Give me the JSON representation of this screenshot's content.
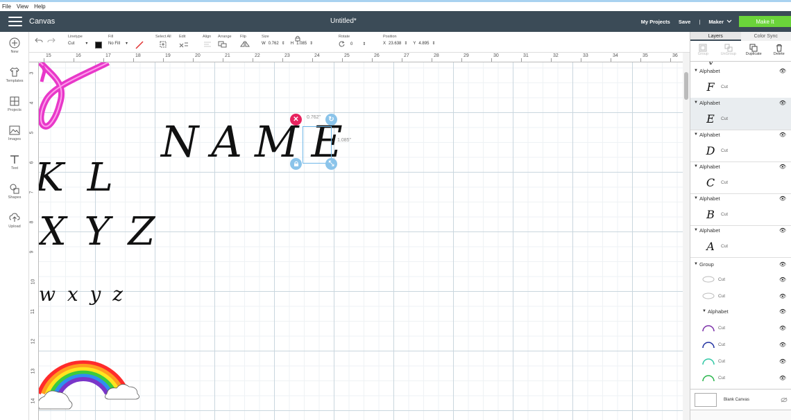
{
  "menu": [
    "File",
    "View",
    "Help"
  ],
  "header": {
    "app": "Canvas",
    "doc_title": "Untitled*",
    "my_projects": "My Projects",
    "save": "Save",
    "separator": "|",
    "machine": "Maker",
    "make_it": "Make It"
  },
  "toolbar": {
    "linetype_label": "Linetype",
    "linetype_value": "Cut",
    "fill_label": "Fill",
    "fill_value": "No Fill",
    "select_all_label": "Select All",
    "edit_label": "Edit",
    "align_label": "Align",
    "arrange_label": "Arrange",
    "flip_label": "Flip",
    "size_label": "Size",
    "w_label": "W",
    "w_value": "0.762",
    "h_label": "H",
    "h_value": "1.085",
    "rotate_label": "Rotate",
    "rotate_value": "0",
    "position_label": "Position",
    "x_label": "X",
    "x_value": "23.638",
    "y_label": "Y",
    "y_value": "4.895"
  },
  "sidebar": {
    "items": [
      {
        "label": "New",
        "icon": "plus-circle-icon"
      },
      {
        "label": "Templates",
        "icon": "shirt-icon"
      },
      {
        "label": "Projects",
        "icon": "projects-icon"
      },
      {
        "label": "Images",
        "icon": "image-icon"
      },
      {
        "label": "Text",
        "icon": "text-icon"
      },
      {
        "label": "Shapes",
        "icon": "shapes-icon"
      },
      {
        "label": "Upload",
        "icon": "upload-icon"
      }
    ]
  },
  "ruler": {
    "top": [
      "15",
      "16",
      "17",
      "18",
      "19",
      "20",
      "21",
      "22",
      "23",
      "24",
      "25",
      "26",
      "27",
      "28",
      "29",
      "30",
      "31",
      "32",
      "33",
      "34",
      "35",
      "36"
    ],
    "left": [
      "3",
      "4",
      "5",
      "6",
      "7",
      "8",
      "9",
      "10",
      "11",
      "12",
      "13",
      "14"
    ]
  },
  "canvas": {
    "name_text": "NAME",
    "letters_kl": "K L",
    "letters_xyz": "X Y Z",
    "letters_lower": "w x y z",
    "selection_width": "0.762\"",
    "selection_height": "1.085\""
  },
  "panel": {
    "tabs": [
      "Layers",
      "Color Sync"
    ],
    "actions": [
      "Group",
      "UnGroup",
      "Duplicate",
      "Delete"
    ],
    "layers": [
      {
        "name": "Alphabet",
        "glyph": "F",
        "op": "Cut"
      },
      {
        "name": "Alphabet",
        "glyph": "E",
        "op": "Cut"
      },
      {
        "name": "Alphabet",
        "glyph": "D",
        "op": "Cut"
      },
      {
        "name": "Alphabet",
        "glyph": "C",
        "op": "Cut"
      },
      {
        "name": "Alphabet",
        "glyph": "B",
        "op": "Cut"
      },
      {
        "name": "Alphabet",
        "glyph": "A",
        "op": "Cut"
      }
    ],
    "group_name": "Group",
    "group_cuts": [
      "Cut",
      "Cut"
    ],
    "sub_alphabet": "Alphabet",
    "sub_cuts": [
      "Cut",
      "Cut",
      "Cut",
      "Cut"
    ],
    "arc_colors": [
      "#7b2fa8",
      "#1f2fa0",
      "#2ec7a4",
      "#27b44a"
    ],
    "blank_canvas": "Blank Canvas"
  },
  "colors": {
    "header": "#3b4b57",
    "make_it": "#6bd43a",
    "selection": "#6fb7e8",
    "delete_handle": "#e8235f",
    "ribbon": "#e838c9"
  }
}
